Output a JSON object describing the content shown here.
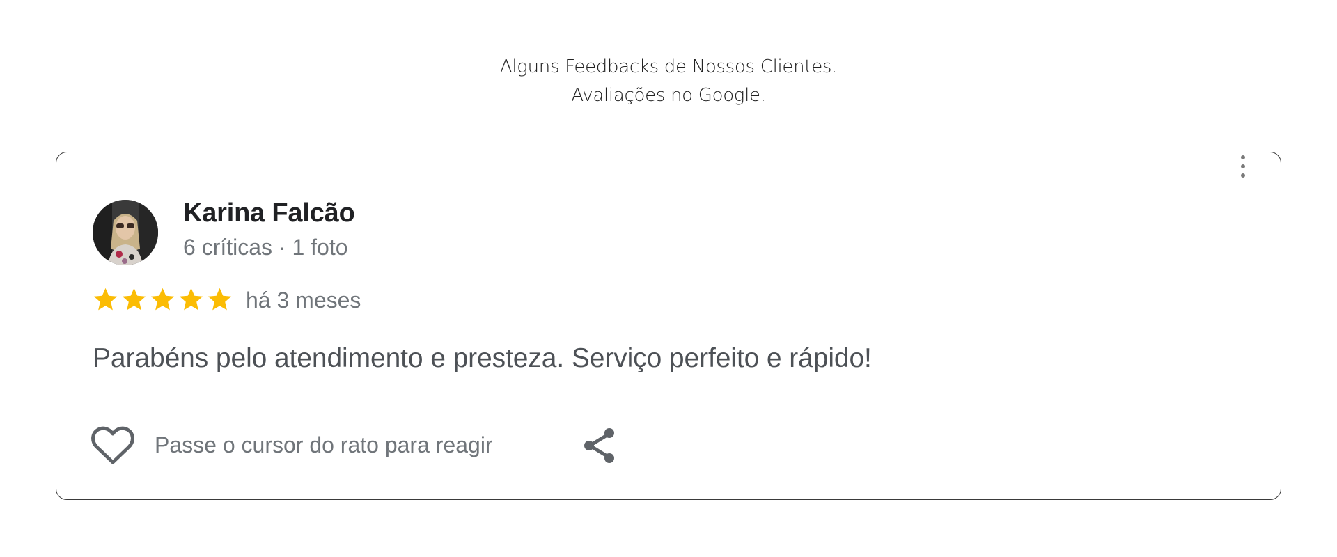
{
  "heading": {
    "line1": "Alguns Feedbacks de Nossos Clientes.",
    "line2": "Avaliações no Google."
  },
  "review": {
    "reviewer_name": "Karina Falcão",
    "reviewer_meta": "6 críticas · 1 foto",
    "rating": 5,
    "rating_max": 5,
    "time_ago": "há 3 meses",
    "text": "Parabéns pelo atendimento e presteza. Serviço perfeito e rápido!",
    "react_label": "Passe o cursor do rato para reagir"
  },
  "icons": {
    "menu": "more-vertical-icon",
    "react": "heart-icon",
    "share": "share-icon",
    "star": "star-icon"
  },
  "colors": {
    "star": "#fbbc04",
    "name": "#202124",
    "secondary_text": "#70757a",
    "body_text": "#4d5156",
    "icon": "#5f6368",
    "card_border": "#3a3a3a"
  }
}
